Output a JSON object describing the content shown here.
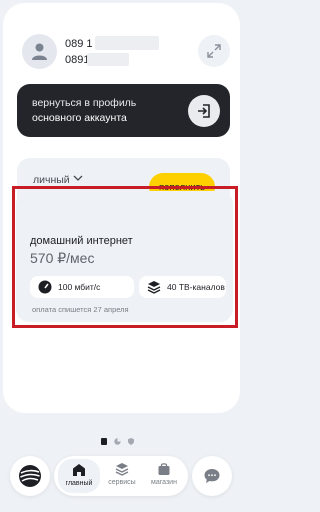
{
  "profile": {
    "phone_primary": "089 1",
    "phone_secondary": "0891",
    "avatar_icon": "person-icon",
    "expand_icon": "expand-icon"
  },
  "return_card": {
    "line1": "вернуться в профиль",
    "line2": "основного аккаунта",
    "icon": "login-arrow-icon"
  },
  "account": {
    "type_label": "личный",
    "balance": ".",
    "topup_label": "пополнить"
  },
  "tariff": {
    "name": "домашний интернет",
    "price": "570 ₽/мес",
    "speed": "100 мбит/с",
    "tv_channels": "40 ТВ-каналов",
    "payment_note": "оплата спишется 27 апреля"
  },
  "nav": {
    "home_label": "главный",
    "services_label": "сервисы",
    "shop_label": "магазин"
  },
  "colors": {
    "accent_yellow": "#ffd000",
    "dark_card": "#23252b",
    "highlight_red": "#c91d25"
  }
}
